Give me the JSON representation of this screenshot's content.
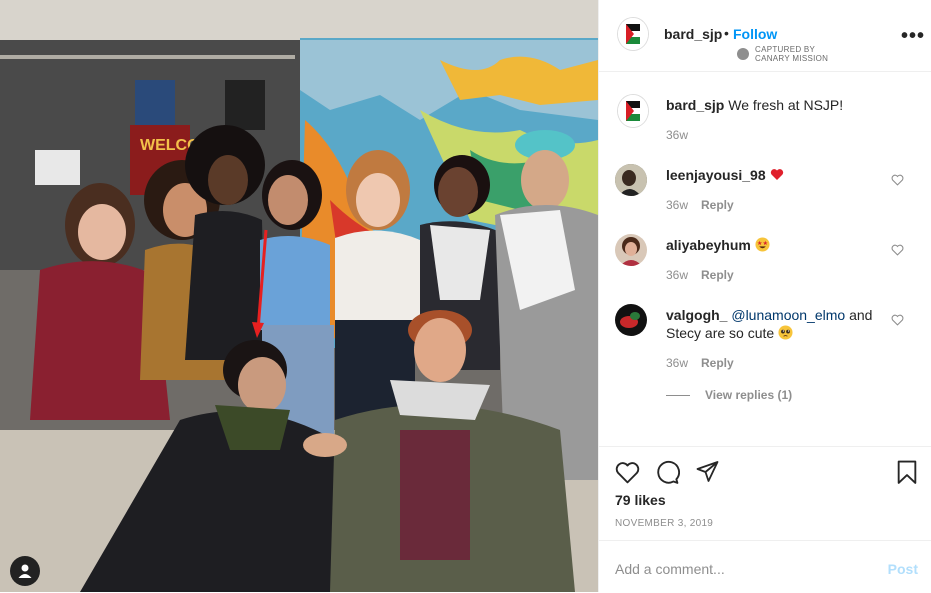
{
  "post": {
    "username": "bard_sjp",
    "follow_label": "Follow",
    "separator": "•",
    "captured_line1": "CAPTURED BY",
    "captured_line2": "CANARY MISSION",
    "more_icon": "more-horizontal-icon",
    "caption_text": "We fresh at NSJP!",
    "caption_age": "36w",
    "likes": "79 likes",
    "date": "NOVEMBER 3, 2019",
    "comment_placeholder": "Add a comment...",
    "post_label": "Post",
    "photo_sign_text": "WELCO"
  },
  "comments": [
    {
      "username": "leenjayousi_98",
      "text": "",
      "emoji": "red-heart-icon",
      "age": "36w",
      "reply": "Reply"
    },
    {
      "username": "aliyabeyhum",
      "text": "",
      "emoji": "star-struck-face-icon",
      "age": "36w",
      "reply": "Reply"
    },
    {
      "username": "valgogh_",
      "mention": "@lunamoon_elmo",
      "text_after": "and Stecy are so cute",
      "emoji": "pleading-face-icon",
      "age": "36w",
      "reply": "Reply"
    }
  ],
  "view_replies": "View replies (1)",
  "colors": {
    "accent": "#0095f6",
    "mention": "#00376b",
    "muted": "#8e8e8e",
    "post_disabled": "#b2dffc",
    "heart": "#ed4956"
  }
}
